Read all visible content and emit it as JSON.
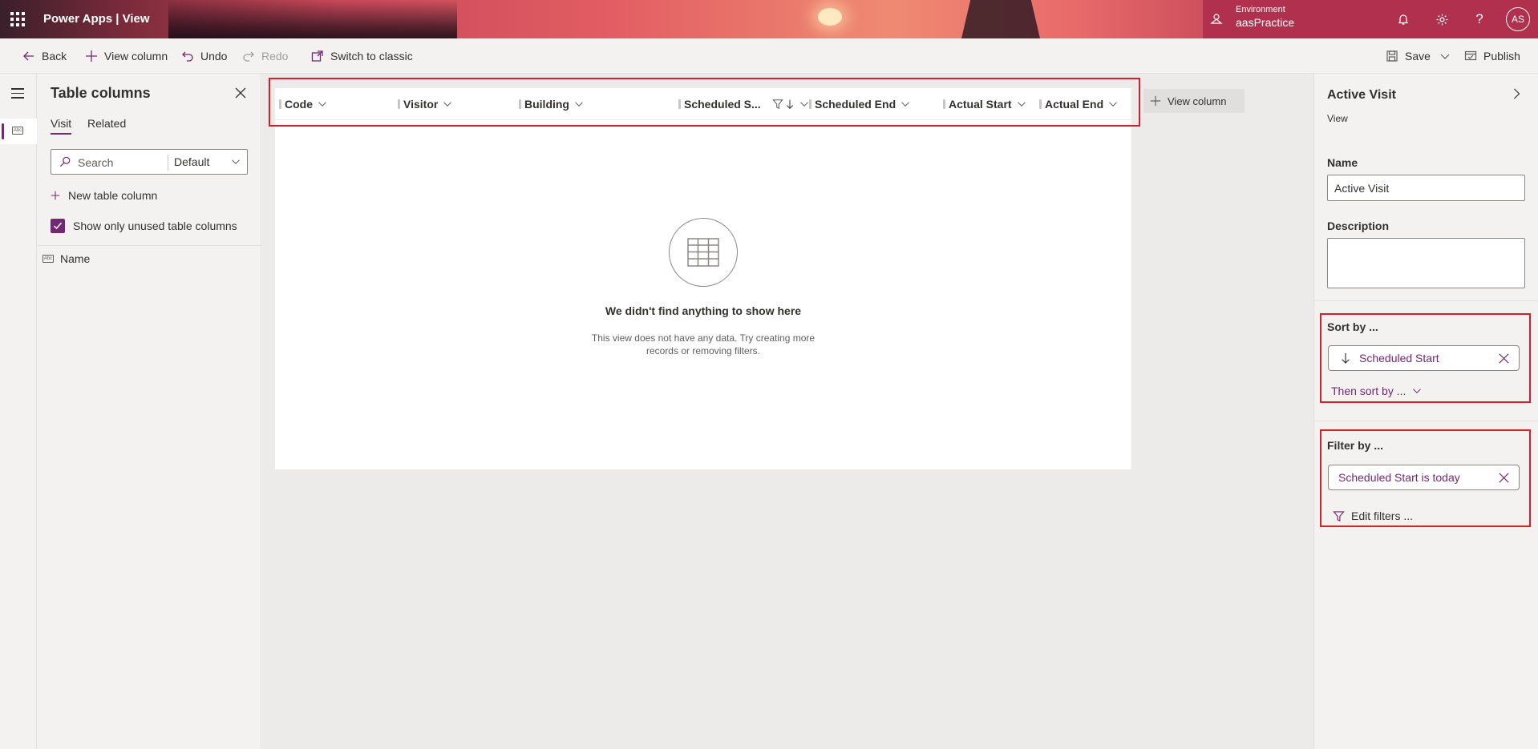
{
  "header": {
    "app_title": "Power Apps  |  View",
    "environment_label": "Environment",
    "environment_name": "aasPractice",
    "avatar_initials": "AS"
  },
  "commandbar": {
    "back": "Back",
    "view_column": "View column",
    "undo": "Undo",
    "redo": "Redo",
    "switch_classic": "Switch to classic",
    "save": "Save",
    "publish": "Publish"
  },
  "table_columns": {
    "title": "Table columns",
    "tabs": [
      "Visit",
      "Related"
    ],
    "active_tab": "Visit",
    "search_placeholder": "Search",
    "filter_value": "Default",
    "new_column": "New table column",
    "show_unused": "Show only unused table columns",
    "show_unused_checked": true,
    "fields": [
      "Name"
    ]
  },
  "grid": {
    "columns": [
      "Code",
      "Visitor",
      "Building",
      "Scheduled S...",
      "Scheduled End",
      "Actual Start",
      "Actual End"
    ],
    "add_column": "View column",
    "empty_title": "We didn't find anything to show here",
    "empty_description": "This view does not have any data. Try creating more records or removing filters."
  },
  "properties": {
    "title": "Active Visit",
    "subtitle": "View",
    "name_label": "Name",
    "name_value": "Active Visit",
    "description_label": "Description",
    "description_value": "",
    "sort_label": "Sort by ...",
    "sort_chip": "Scheduled Start",
    "then_sort": "Then sort by ...",
    "filter_label": "Filter by ...",
    "filter_chip": "Scheduled Start is today",
    "edit_filters": "Edit filters ..."
  },
  "colors": {
    "accent": "#742774",
    "highlight_outline": "#d71f2c"
  }
}
